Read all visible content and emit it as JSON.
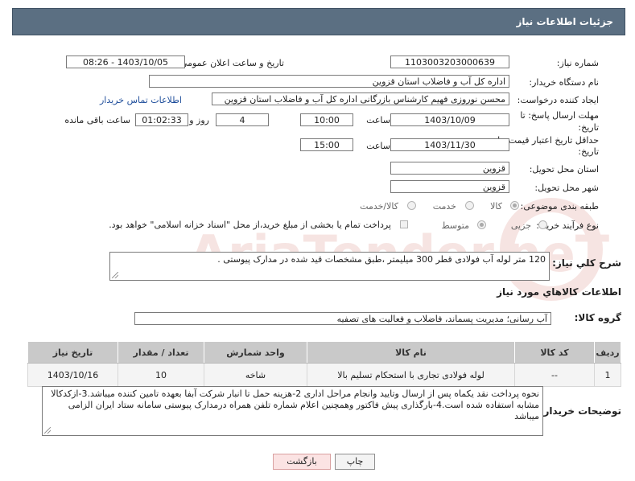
{
  "header": {
    "title": "جزئیات اطلاعات نیاز"
  },
  "form": {
    "need_number_label": "شماره نیاز:",
    "need_number": "1103003203000639",
    "announce_label": "تاریخ و ساعت اعلان عمومی:",
    "announce_value": "1403/10/05 - 08:26",
    "buyer_org_label": "نام دستگاه خریدار:",
    "buyer_org": "اداره کل آب و فاضلاب استان قزوین",
    "creator_label": "ایجاد کننده درخواست:",
    "creator": "محسن نوروزی فهیم کارشناس بازرگانی اداره کل آب و فاضلاب استان قزوین",
    "contact_link": "اطلاعات تماس خریدار",
    "deadline_label_1": "مهلت ارسال پاسخ: تا",
    "deadline_label_2": "تاریخ:",
    "deadline_date": "1403/10/09",
    "time_label": "ساعت",
    "deadline_time": "10:00",
    "days_value": "4",
    "days_label": "روز و",
    "remaining_value": "01:02:33",
    "remaining_label": "ساعت باقی مانده",
    "validity_label_1": "حداقل تاریخ اعتبار قیمت: تا",
    "validity_label_2": "تاریخ:",
    "validity_date": "1403/11/30",
    "validity_time_label": "ساعت",
    "validity_time": "15:00",
    "province_label": "استان محل تحویل:",
    "province": "قزوین",
    "city_label": "شهر محل تحویل:",
    "city": "قزوین",
    "category_label": "طبقه بندی موضوعی:",
    "category_options": [
      "کالا",
      "خدمت",
      "کالا/خدمت"
    ],
    "process_label": "نوع فرآیند خرید :",
    "process_options": [
      "جزیی",
      "متوسط"
    ],
    "payment_note": "پرداخت تمام یا بخشی از مبلغ خرید،از محل \"اسناد خزانه اسلامی\" خواهد بود."
  },
  "summary": {
    "label": "شرح کلي نياز:",
    "text": "120 متر لوله آب فولادی قطر 300 میلیمتر ،طبق مشخصات قید شده در مدارک پیوستی ."
  },
  "goods_section": {
    "title": "اطلاعات کالاهاي مورد نياز",
    "group_label": "گروه کالا:",
    "group_value": "آب رسانی؛ مدیریت پسماند، فاضلاب و فعالیت های تصفیه"
  },
  "table": {
    "headers": [
      "ردیف",
      "کد کالا",
      "نام کالا",
      "واحد شمارش",
      "تعداد / مقدار",
      "تاریخ نیاز"
    ],
    "rows": [
      [
        "1",
        "--",
        "لوله فولادی تجاری با استحکام تسلیم بالا",
        "شاخه",
        "10",
        "1403/10/16"
      ]
    ]
  },
  "buyer_notes": {
    "label": "توضیحات خریدار:",
    "text": "نحوه پرداخت نقد یکماه پس از ارسال وتایید وانجام مراحل اداری 2-هزینه حمل تا انبار شرکت آبفا بعهده تامین کننده میباشد.3-ازکدکالا مشابه استفاده شده است.4-بارگذاری پیش فاکتور وهمچنین اعلام شماره تلفن همراه درمدارک پیوستی سامانه ستاد ایران الزامی میباشد"
  },
  "buttons": {
    "print": "چاپ",
    "back": "بازگشت"
  },
  "watermark": {
    "text": "AriaTender.neT"
  },
  "colors": {
    "header_bg": "#5b6f82",
    "link": "#1f4e9b",
    "back_button_bg": "#fbe3e3"
  }
}
